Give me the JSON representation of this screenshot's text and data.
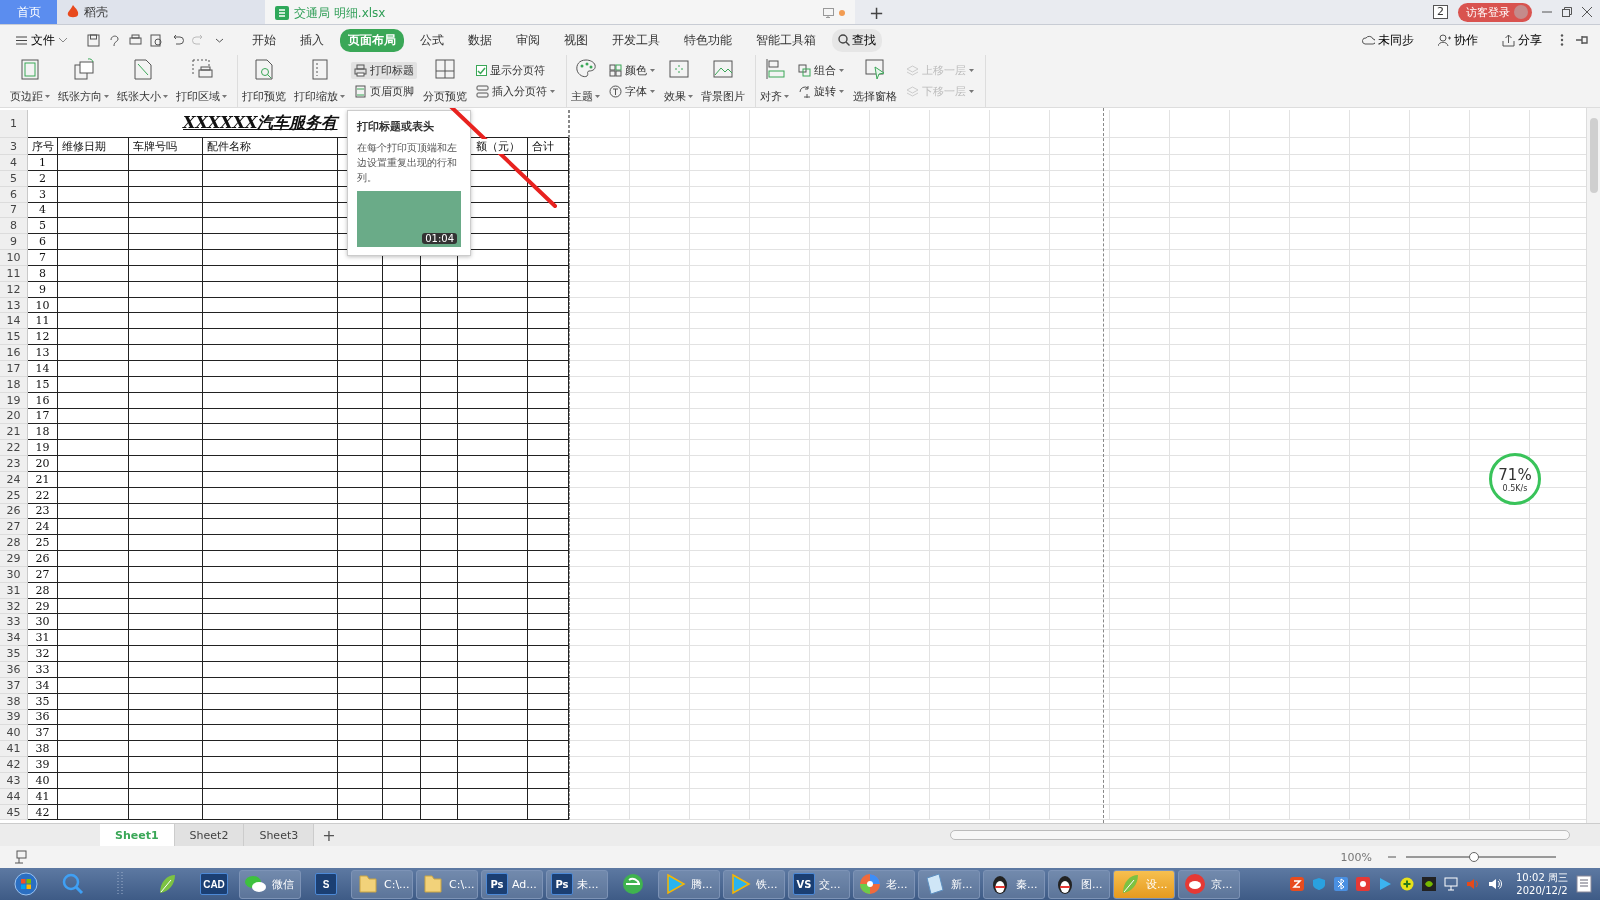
{
  "app_tabs": [
    {
      "label": "首页",
      "kind": "home",
      "selected": false
    },
    {
      "label": "稻壳",
      "kind": "docer",
      "selected": false
    },
    {
      "label": "交通局 明细.xlsx",
      "kind": "sheet",
      "selected": true
    }
  ],
  "new_tab": "+",
  "title_bar": {
    "window_count": "2",
    "login": "访客登录"
  },
  "menu": {
    "file": "文件",
    "tabs": [
      {
        "label": "开始",
        "selected": false
      },
      {
        "label": "插入",
        "selected": false
      },
      {
        "label": "页面布局",
        "selected": true
      },
      {
        "label": "公式",
        "selected": false
      },
      {
        "label": "数据",
        "selected": false
      },
      {
        "label": "审阅",
        "selected": false
      },
      {
        "label": "视图",
        "selected": false
      },
      {
        "label": "开发工具",
        "selected": false
      },
      {
        "label": "特色功能",
        "selected": false
      },
      {
        "label": "智能工具箱",
        "selected": false
      }
    ],
    "search": "查找",
    "right": [
      "未同步",
      "协作",
      "分享"
    ]
  },
  "ribbon": [
    [
      {
        "kind": "large",
        "label": "页边距",
        "dropdown": true
      },
      {
        "kind": "large",
        "label": "纸张方向",
        "dropdown": true
      },
      {
        "kind": "large",
        "label": "纸张大小",
        "dropdown": true
      },
      {
        "kind": "large",
        "label": "打印区域",
        "dropdown": true
      }
    ],
    [
      {
        "kind": "large",
        "label": "打印预览",
        "dropdown": false
      },
      {
        "kind": "large",
        "label": "打印缩放",
        "dropdown": true
      },
      {
        "kind": "stack",
        "items": [
          {
            "kind": "small",
            "label": "打印标题",
            "dropdown": false,
            "highlighted": true,
            "disabled": false
          },
          {
            "kind": "small",
            "label": "页眉页脚",
            "dropdown": false,
            "highlighted": false,
            "disabled": false
          }
        ]
      },
      {
        "kind": "large",
        "label": "分页预览",
        "dropdown": false
      },
      {
        "kind": "stack",
        "items": [
          {
            "kind": "check",
            "label": "显示分页符",
            "checked": true,
            "disabled": false
          },
          {
            "kind": "small",
            "label": "插入分页符",
            "dropdown": true,
            "highlighted": false,
            "disabled": false
          }
        ]
      }
    ],
    [
      {
        "kind": "large",
        "label": "主题",
        "dropdown": true
      },
      {
        "kind": "stack",
        "items": [
          {
            "kind": "small",
            "label": "颜色",
            "dropdown": true,
            "highlighted": false,
            "disabled": false
          },
          {
            "kind": "small",
            "label": "字体",
            "dropdown": true,
            "highlighted": false,
            "disabled": false
          }
        ]
      },
      {
        "kind": "large",
        "label": "效果",
        "dropdown": true
      },
      {
        "kind": "large",
        "label": "背景图片",
        "dropdown": false
      }
    ],
    [
      {
        "kind": "large",
        "label": "对齐",
        "dropdown": true
      },
      {
        "kind": "stack",
        "items": [
          {
            "kind": "small",
            "label": "组合",
            "dropdown": true,
            "highlighted": false,
            "disabled": false
          },
          {
            "kind": "small",
            "label": "旋转",
            "dropdown": true,
            "highlighted": false,
            "disabled": false
          }
        ]
      },
      {
        "kind": "large",
        "label": "选择窗格",
        "dropdown": false
      },
      {
        "kind": "stack",
        "items": [
          {
            "kind": "small",
            "label": "上移一层",
            "dropdown": true,
            "highlighted": false,
            "disabled": true
          },
          {
            "kind": "small",
            "label": "下移一层",
            "dropdown": true,
            "highlighted": false,
            "disabled": true
          }
        ]
      }
    ]
  ],
  "sheet": {
    "title": "XXXXXX汽车服务有",
    "columns": [
      {
        "header": "序号"
      },
      {
        "header": "维修日期"
      },
      {
        "header": "车牌号吗"
      },
      {
        "header": "配件名称"
      },
      {},
      {},
      {},
      {
        "header": "额（元）"
      },
      {
        "header": "合计"
      }
    ],
    "row_numbers": [
      "1",
      "3",
      "4",
      "5",
      "6",
      "7",
      "8",
      "9",
      "10",
      "11",
      "12",
      "13",
      "14",
      "15",
      "16",
      "17",
      "18",
      "19",
      "20",
      "21",
      "22",
      "23",
      "24",
      "25",
      "26",
      "27",
      "28",
      "29",
      "30",
      "31",
      "32",
      "33",
      "34",
      "35",
      "36",
      "37",
      "38",
      "39",
      "40",
      "41",
      "42",
      "43",
      "44",
      "45"
    ],
    "serials": [
      "1",
      "2",
      "3",
      "4",
      "5",
      "6",
      "7",
      "8",
      "9",
      "10",
      "11",
      "12",
      "13",
      "14",
      "15",
      "16",
      "17",
      "18",
      "19",
      "20",
      "21",
      "22",
      "23",
      "24",
      "25",
      "26",
      "27",
      "28",
      "29",
      "30",
      "31",
      "32",
      "33",
      "34",
      "35",
      "36",
      "37",
      "38",
      "39",
      "40",
      "41",
      "42"
    ]
  },
  "tooltip": {
    "title": "打印标题或表头",
    "body": "在每个打印页顶端和左边设置重复出现的行和列。",
    "duration": "01:04"
  },
  "speed_widget": {
    "percent": "71%",
    "rate": "0.5K/s"
  },
  "sheet_tabs": [
    {
      "label": "Sheet1",
      "selected": true
    },
    {
      "label": "Sheet2",
      "selected": false
    },
    {
      "label": "Sheet3",
      "selected": false
    }
  ],
  "add_sheet": "+",
  "status_bar": {
    "zoom": "100%",
    "zoom_slider": {
      "level": 0.45
    }
  },
  "taskbar": [
    {
      "kind": "pinned"
    },
    {
      "kind": "pinned"
    },
    {
      "kind": "pinned"
    },
    {
      "kind": "pinned"
    },
    {
      "kind": "pinned",
      "icon_text": "CAD"
    },
    {
      "kind": "window",
      "label": "微信",
      "selected": false
    },
    {
      "kind": "pinned",
      "icon_text": "S"
    },
    {
      "kind": "window",
      "label": "C:\\...",
      "selected": false
    },
    {
      "kind": "window",
      "label": "C:\\...",
      "selected": false
    },
    {
      "kind": "window",
      "icon_text": "Ps",
      "label": "Ad...",
      "selected": false
    },
    {
      "kind": "window",
      "icon_text": "Ps",
      "label": "未...",
      "selected": false
    },
    {
      "kind": "pinned"
    },
    {
      "kind": "window",
      "label": "腾...",
      "selected": false
    },
    {
      "kind": "window",
      "label": "铁...",
      "selected": false
    },
    {
      "kind": "window",
      "icon_text": "VS",
      "label": "交...",
      "selected": false
    },
    {
      "kind": "window",
      "label": "老...",
      "selected": false
    },
    {
      "kind": "window",
      "label": "新...",
      "selected": false
    },
    {
      "kind": "window",
      "label": "秦...",
      "selected": false
    },
    {
      "kind": "window",
      "label": "图...",
      "selected": false
    },
    {
      "kind": "window",
      "label": "设...",
      "selected": true
    },
    {
      "kind": "window",
      "label": "京...",
      "selected": false
    }
  ],
  "clock": {
    "time": "10:02 周三",
    "date": "2020/12/2"
  }
}
